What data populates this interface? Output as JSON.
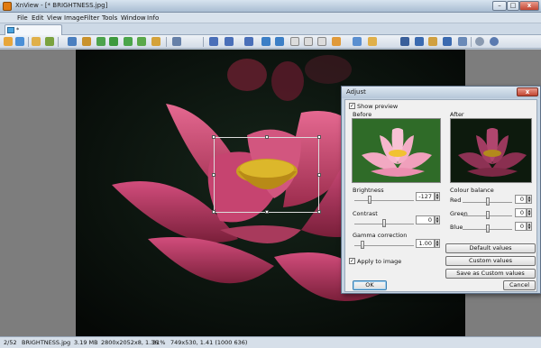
{
  "window": {
    "title": "XnView - [* BRIGHTNESS.jpg]",
    "min": "–",
    "max": "□",
    "close": "x"
  },
  "menu": [
    "File",
    "Edit",
    "View",
    "Image",
    "Filter",
    "Tools",
    "Window",
    "Info"
  ],
  "tab": {
    "label": "* BRIGHTNESS.jpg"
  },
  "toolbar": {
    "icons": [
      "folder-icon",
      "nav-icon",
      "thumbs-icon",
      "refresh-icon",
      "rotate-icon",
      "rotate-icon",
      "image-icon",
      "image-icon",
      "tools-icon",
      "save-icon",
      "zoom-in-icon",
      "zoom-out-icon",
      "zoom-out-icon",
      "prev-icon",
      "next-icon",
      "fit-icon",
      "page-icon",
      "page-icon",
      "slideshow-icon",
      "copy-icon",
      "paste-icon",
      "binoculars-icon",
      "monitor-icon",
      "scan-icon",
      "print-icon",
      "settings-icon",
      "info-icon"
    ]
  },
  "status": {
    "index": "2/52",
    "filename": "BRIGHTNESS.jpg",
    "size": "3.19 MB",
    "dims": "2800x2052x8, 1.36",
    "zoom": "31%",
    "selection": "749x530, 1.41 (1000 636)"
  },
  "dialog": {
    "title": "Adjust",
    "close": "x",
    "show_preview": "Show preview",
    "before": "Before",
    "after": "After",
    "brightness": {
      "label": "Brightness",
      "value": "-127",
      "level": -127,
      "min": -255,
      "max": 255
    },
    "contrast": {
      "label": "Contrast",
      "value": "0",
      "level": 0,
      "min": -100,
      "max": 100
    },
    "gamma": {
      "label": "Gamma correction",
      "value": "1.00",
      "level": 1.0,
      "min": 0.01,
      "max": 6.99
    },
    "colour_balance": {
      "label": "Colour balance",
      "red": {
        "label": "Red",
        "value": "0",
        "level": 0
      },
      "green": {
        "label": "Green",
        "value": "0",
        "level": 0
      },
      "blue": {
        "label": "Blue",
        "value": "0",
        "level": 0
      }
    },
    "apply_to_image": "Apply to image",
    "default_values": "Default values",
    "custom_values": "Custom values",
    "save_custom": "Save as Custom values",
    "ok": "OK",
    "cancel": "Cancel"
  },
  "colors": {
    "titlebar": "#a9bdd2",
    "dialog_bg": "#f0f0f0",
    "flower": "#c2416a",
    "accent": "#3c7fb1"
  }
}
